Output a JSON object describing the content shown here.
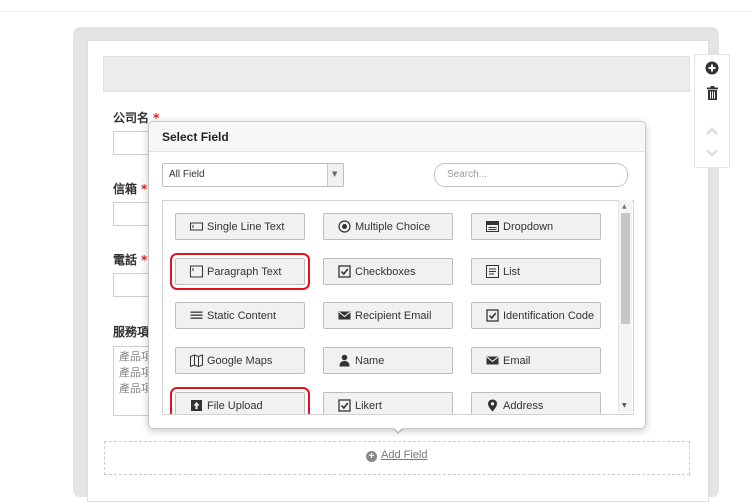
{
  "form": {
    "fields": [
      {
        "label": "公司名",
        "required_mark": "*"
      },
      {
        "label": "信箱",
        "required_mark": "*"
      },
      {
        "label": "電話",
        "required_mark": "*"
      },
      {
        "label": "服務項",
        "required_mark": ""
      }
    ],
    "textarea_lines": [
      "產品項",
      "產品項",
      "產品項"
    ],
    "add_field_label": "Add Field"
  },
  "modal": {
    "title": "Select Field",
    "select_value": "All Field",
    "search_placeholder": "Search...",
    "field_types": [
      {
        "label": "Single Line Text",
        "icon": "single-line-icon",
        "highlighted": false
      },
      {
        "label": "Multiple Choice",
        "icon": "radio-icon",
        "highlighted": false
      },
      {
        "label": "Dropdown",
        "icon": "dropdown-icon",
        "highlighted": false
      },
      {
        "label": "Paragraph Text",
        "icon": "paragraph-icon",
        "highlighted": true
      },
      {
        "label": "Checkboxes",
        "icon": "checkbox-icon",
        "highlighted": false
      },
      {
        "label": "List",
        "icon": "list-icon",
        "highlighted": false
      },
      {
        "label": "Static Content",
        "icon": "static-content-icon",
        "highlighted": false
      },
      {
        "label": "Recipient Email",
        "icon": "envelope-icon",
        "highlighted": false
      },
      {
        "label": "Identification Code",
        "icon": "checkbox-icon",
        "highlighted": false
      },
      {
        "label": "Google Maps",
        "icon": "map-icon",
        "highlighted": false
      },
      {
        "label": "Name",
        "icon": "person-icon",
        "highlighted": false
      },
      {
        "label": "Email",
        "icon": "envelope-icon",
        "highlighted": false
      },
      {
        "label": "File Upload",
        "icon": "upload-icon",
        "highlighted": true
      },
      {
        "label": "Likert",
        "icon": "checkbox-icon",
        "highlighted": false
      },
      {
        "label": "Address",
        "icon": "map-pin-icon",
        "highlighted": false
      }
    ]
  },
  "colors": {
    "required": "#e02020",
    "highlight_border": "#e0141e",
    "button_bg": "#f1f1f1"
  }
}
